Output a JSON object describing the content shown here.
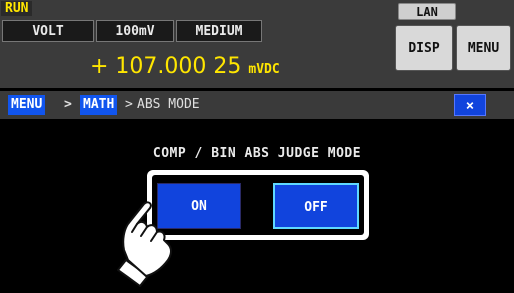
{
  "status": {
    "run": "RUN",
    "lan": "LAN"
  },
  "params": {
    "function": "VOLT",
    "range": "100mV",
    "speed": "MEDIUM"
  },
  "buttons": {
    "disp": "DISP",
    "menu": "MENU"
  },
  "reading": {
    "value": "+ 107.000 25",
    "unit": "mVDC"
  },
  "breadcrumb": {
    "menu": "MENU",
    "sep1": ">",
    "math": "MATH",
    "sep2": ">",
    "current": "ABS MODE"
  },
  "close_label": "×",
  "dialog": {
    "title": "COMP / BIN ABS JUDGE MODE",
    "on_label": "ON",
    "off_label": "OFF"
  },
  "colors": {
    "accent_blue": "#1144dd",
    "reading_yellow": "#ffe600",
    "selected_border": "#5fd8ff"
  }
}
